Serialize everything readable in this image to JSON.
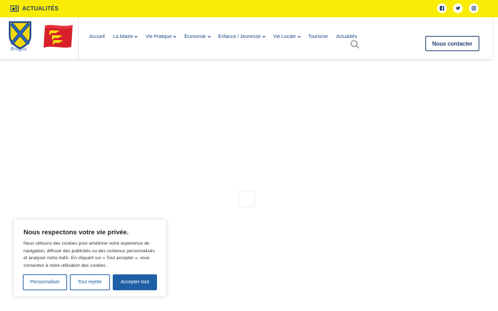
{
  "topbar": {
    "news_label": "ACTUALITÉS",
    "news_icon": "newspaper-icon",
    "socials": [
      {
        "name": "facebook-icon"
      },
      {
        "name": "twitter-icon"
      },
      {
        "name": "instagram-icon"
      }
    ],
    "background_color": "#f9ec06"
  },
  "header": {
    "crest_caption": "Broglie",
    "nav": [
      {
        "label": "Accueil",
        "has_dropdown": false
      },
      {
        "label": "La Mairie",
        "has_dropdown": true
      },
      {
        "label": "Vie Pratique",
        "has_dropdown": true
      },
      {
        "label": "Économie",
        "has_dropdown": true
      },
      {
        "label": "Enfance / Jeunesse",
        "has_dropdown": true
      },
      {
        "label": "Vie Locale",
        "has_dropdown": true
      },
      {
        "label": "Tourisme",
        "has_dropdown": false
      },
      {
        "label": "Actualités",
        "has_dropdown": false
      }
    ],
    "search_icon": "search-icon",
    "contact_label": "Nous contacter"
  },
  "cookie": {
    "title": "Nous respectons votre vie privée.",
    "text": "Nous utilisons des cookies pour améliorer votre expérience de navigation, diffuser des publicités ou des contenus personnalisés et analyser notre trafic. En cliquant sur « Tout accepter », vous consentez à notre utilisation des cookies.",
    "customize_label": "Personnaliser",
    "reject_label": "Tout rejeter",
    "accept_label": "Accepter tout",
    "accent_color": "#1f5fa6"
  },
  "colors": {
    "brand_navy": "#1f3a6b",
    "nav_text": "#1f4a8a"
  }
}
